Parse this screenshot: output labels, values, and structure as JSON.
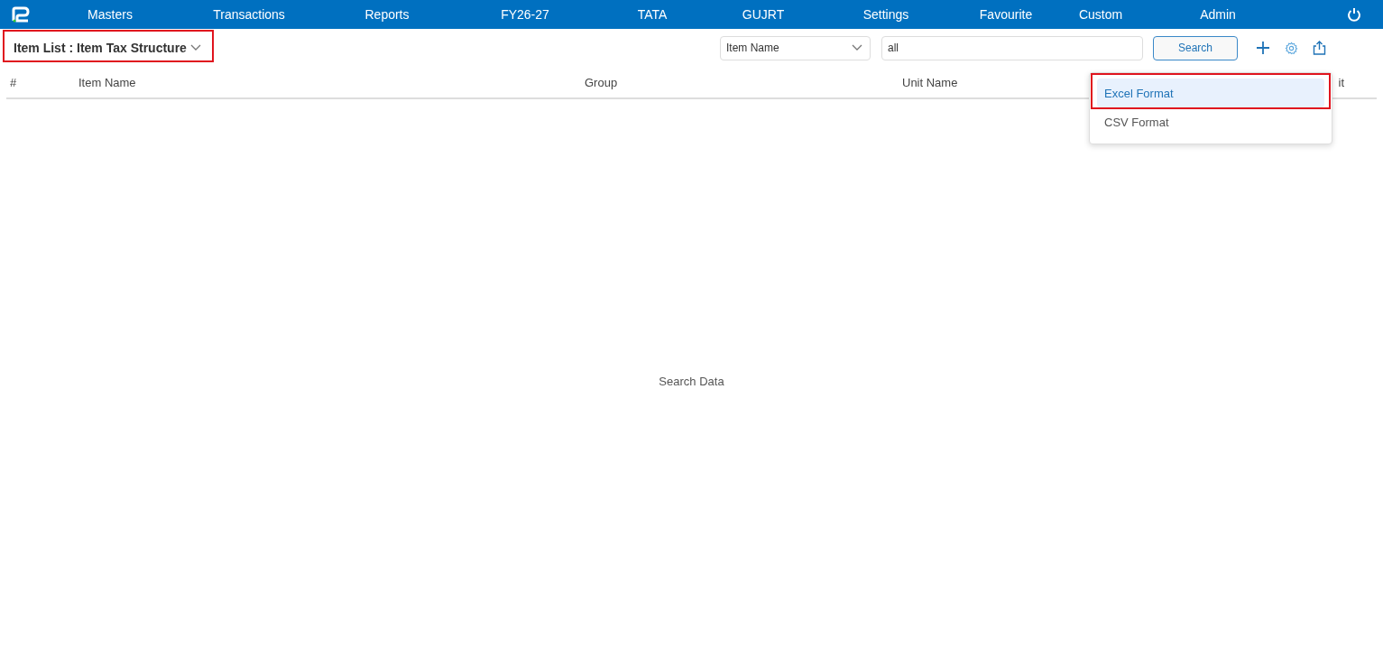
{
  "nav": {
    "items": [
      "Masters",
      "Transactions",
      "Reports",
      "FY26-27",
      "TATA",
      "GUJRT",
      "Settings",
      "Favourite",
      "Custom",
      "Admin"
    ]
  },
  "page_title": "Item List : Item Tax Structure",
  "toolbar": {
    "field_select": "Item Name",
    "search_value": "all",
    "search_button": "Search"
  },
  "table": {
    "columns": [
      "#",
      "Item Name",
      "Group",
      "Unit Name",
      "it"
    ],
    "empty_text": "Search Data"
  },
  "export_menu": {
    "items": [
      {
        "label": "Excel Format",
        "selected": true
      },
      {
        "label": "CSV Format",
        "selected": false
      }
    ]
  }
}
